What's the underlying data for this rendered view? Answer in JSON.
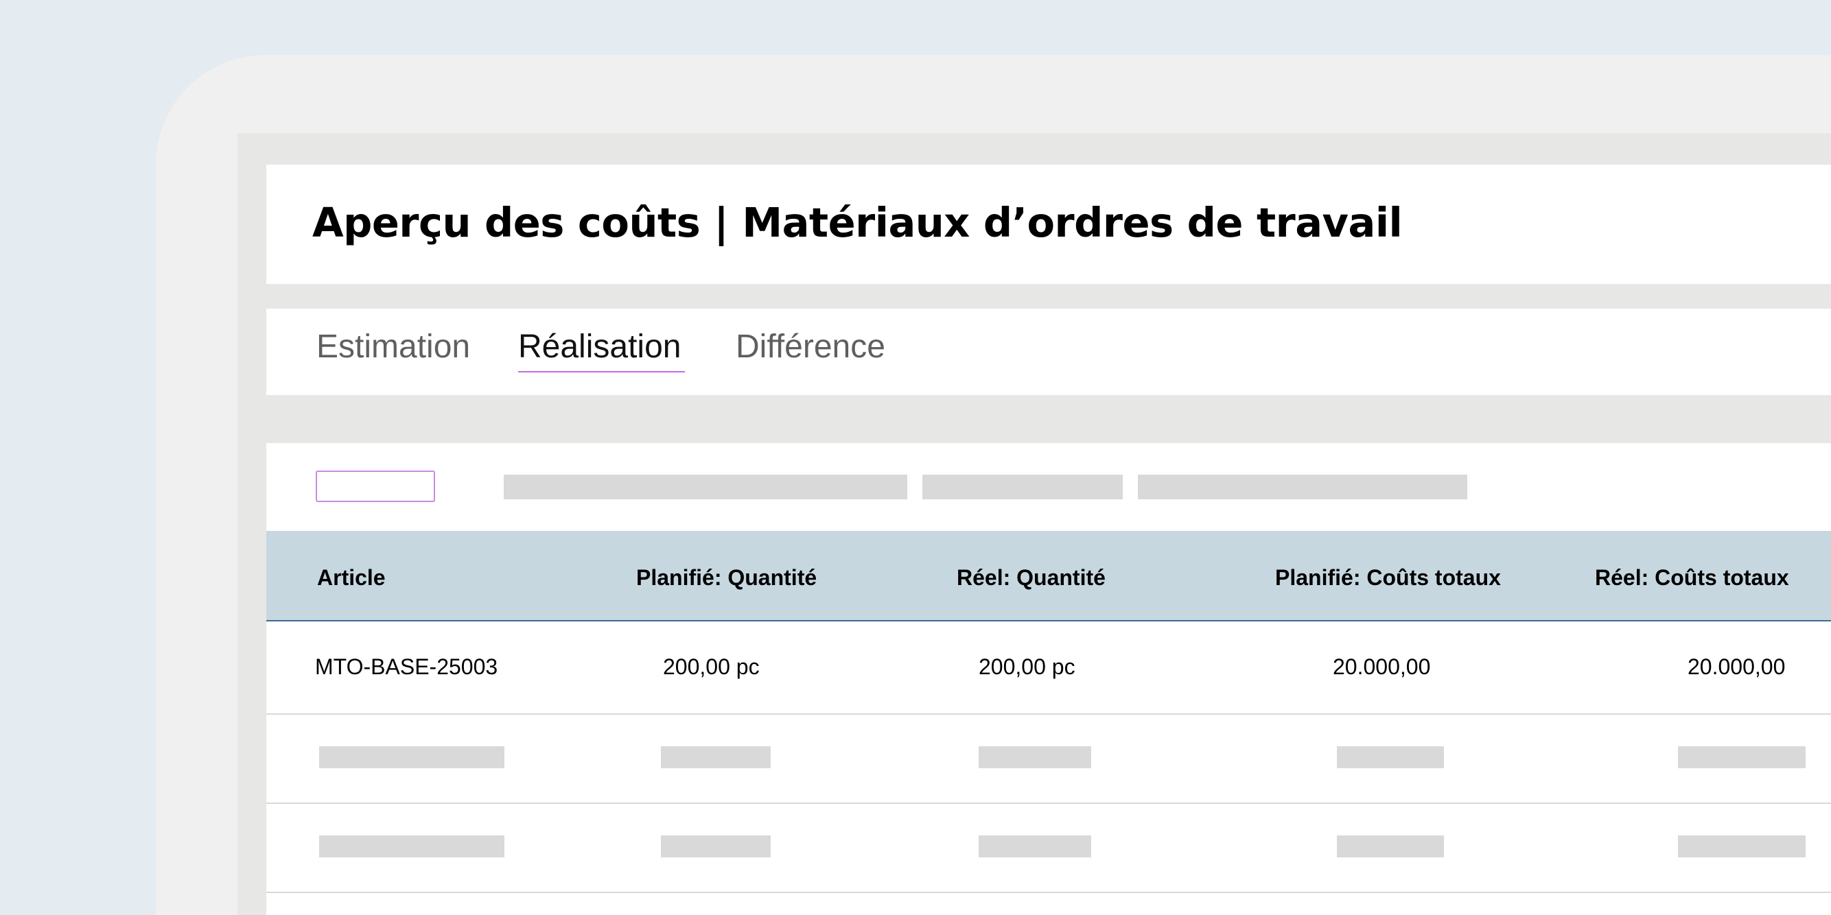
{
  "header": {
    "title": "Aperçu des coûts | Matériaux d’ordres de travail"
  },
  "tabs": [
    {
      "label": "Estimation",
      "active": false
    },
    {
      "label": "Réalisation",
      "active": true
    },
    {
      "label": "Différence",
      "active": false
    }
  ],
  "table": {
    "columns": [
      "Article",
      "Planifié: Quantité",
      "Réel: Quantité",
      "Planifié: Coûts totaux",
      "Réel: Coûts totaux"
    ],
    "rows": [
      [
        "MTO-BASE-25003",
        "200,00 pc",
        "200,00 pc",
        "20.000,00",
        "20.000,00"
      ]
    ]
  },
  "colors": {
    "background": "#e4ebf1",
    "header_row": "#c6d7e0",
    "accent": "#c569e0",
    "header_border": "#3d6a95",
    "skeleton": "#d9d9d9"
  }
}
